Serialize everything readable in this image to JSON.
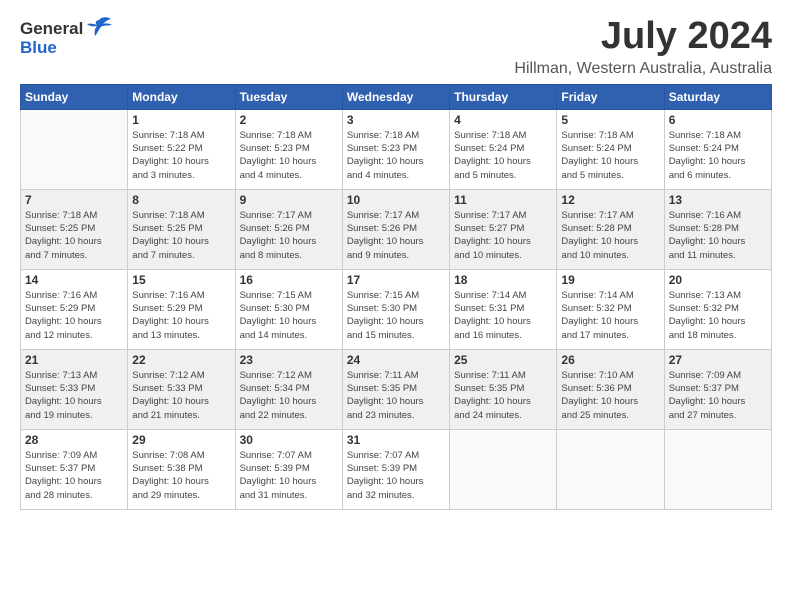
{
  "logo": {
    "general": "General",
    "blue": "Blue"
  },
  "title": "July 2024",
  "subtitle": "Hillman, Western Australia, Australia",
  "days_of_week": [
    "Sunday",
    "Monday",
    "Tuesday",
    "Wednesday",
    "Thursday",
    "Friday",
    "Saturday"
  ],
  "weeks": [
    [
      {
        "day": "",
        "info": ""
      },
      {
        "day": "1",
        "info": "Sunrise: 7:18 AM\nSunset: 5:22 PM\nDaylight: 10 hours\nand 3 minutes."
      },
      {
        "day": "2",
        "info": "Sunrise: 7:18 AM\nSunset: 5:23 PM\nDaylight: 10 hours\nand 4 minutes."
      },
      {
        "day": "3",
        "info": "Sunrise: 7:18 AM\nSunset: 5:23 PM\nDaylight: 10 hours\nand 4 minutes."
      },
      {
        "day": "4",
        "info": "Sunrise: 7:18 AM\nSunset: 5:24 PM\nDaylight: 10 hours\nand 5 minutes."
      },
      {
        "day": "5",
        "info": "Sunrise: 7:18 AM\nSunset: 5:24 PM\nDaylight: 10 hours\nand 5 minutes."
      },
      {
        "day": "6",
        "info": "Sunrise: 7:18 AM\nSunset: 5:24 PM\nDaylight: 10 hours\nand 6 minutes."
      }
    ],
    [
      {
        "day": "7",
        "info": "Sunrise: 7:18 AM\nSunset: 5:25 PM\nDaylight: 10 hours\nand 7 minutes."
      },
      {
        "day": "8",
        "info": "Sunrise: 7:18 AM\nSunset: 5:25 PM\nDaylight: 10 hours\nand 7 minutes."
      },
      {
        "day": "9",
        "info": "Sunrise: 7:17 AM\nSunset: 5:26 PM\nDaylight: 10 hours\nand 8 minutes."
      },
      {
        "day": "10",
        "info": "Sunrise: 7:17 AM\nSunset: 5:26 PM\nDaylight: 10 hours\nand 9 minutes."
      },
      {
        "day": "11",
        "info": "Sunrise: 7:17 AM\nSunset: 5:27 PM\nDaylight: 10 hours\nand 10 minutes."
      },
      {
        "day": "12",
        "info": "Sunrise: 7:17 AM\nSunset: 5:28 PM\nDaylight: 10 hours\nand 10 minutes."
      },
      {
        "day": "13",
        "info": "Sunrise: 7:16 AM\nSunset: 5:28 PM\nDaylight: 10 hours\nand 11 minutes."
      }
    ],
    [
      {
        "day": "14",
        "info": "Sunrise: 7:16 AM\nSunset: 5:29 PM\nDaylight: 10 hours\nand 12 minutes."
      },
      {
        "day": "15",
        "info": "Sunrise: 7:16 AM\nSunset: 5:29 PM\nDaylight: 10 hours\nand 13 minutes."
      },
      {
        "day": "16",
        "info": "Sunrise: 7:15 AM\nSunset: 5:30 PM\nDaylight: 10 hours\nand 14 minutes."
      },
      {
        "day": "17",
        "info": "Sunrise: 7:15 AM\nSunset: 5:30 PM\nDaylight: 10 hours\nand 15 minutes."
      },
      {
        "day": "18",
        "info": "Sunrise: 7:14 AM\nSunset: 5:31 PM\nDaylight: 10 hours\nand 16 minutes."
      },
      {
        "day": "19",
        "info": "Sunrise: 7:14 AM\nSunset: 5:32 PM\nDaylight: 10 hours\nand 17 minutes."
      },
      {
        "day": "20",
        "info": "Sunrise: 7:13 AM\nSunset: 5:32 PM\nDaylight: 10 hours\nand 18 minutes."
      }
    ],
    [
      {
        "day": "21",
        "info": "Sunrise: 7:13 AM\nSunset: 5:33 PM\nDaylight: 10 hours\nand 19 minutes."
      },
      {
        "day": "22",
        "info": "Sunrise: 7:12 AM\nSunset: 5:33 PM\nDaylight: 10 hours\nand 21 minutes."
      },
      {
        "day": "23",
        "info": "Sunrise: 7:12 AM\nSunset: 5:34 PM\nDaylight: 10 hours\nand 22 minutes."
      },
      {
        "day": "24",
        "info": "Sunrise: 7:11 AM\nSunset: 5:35 PM\nDaylight: 10 hours\nand 23 minutes."
      },
      {
        "day": "25",
        "info": "Sunrise: 7:11 AM\nSunset: 5:35 PM\nDaylight: 10 hours\nand 24 minutes."
      },
      {
        "day": "26",
        "info": "Sunrise: 7:10 AM\nSunset: 5:36 PM\nDaylight: 10 hours\nand 25 minutes."
      },
      {
        "day": "27",
        "info": "Sunrise: 7:09 AM\nSunset: 5:37 PM\nDaylight: 10 hours\nand 27 minutes."
      }
    ],
    [
      {
        "day": "28",
        "info": "Sunrise: 7:09 AM\nSunset: 5:37 PM\nDaylight: 10 hours\nand 28 minutes."
      },
      {
        "day": "29",
        "info": "Sunrise: 7:08 AM\nSunset: 5:38 PM\nDaylight: 10 hours\nand 29 minutes."
      },
      {
        "day": "30",
        "info": "Sunrise: 7:07 AM\nSunset: 5:39 PM\nDaylight: 10 hours\nand 31 minutes."
      },
      {
        "day": "31",
        "info": "Sunrise: 7:07 AM\nSunset: 5:39 PM\nDaylight: 10 hours\nand 32 minutes."
      },
      {
        "day": "",
        "info": ""
      },
      {
        "day": "",
        "info": ""
      },
      {
        "day": "",
        "info": ""
      }
    ]
  ]
}
